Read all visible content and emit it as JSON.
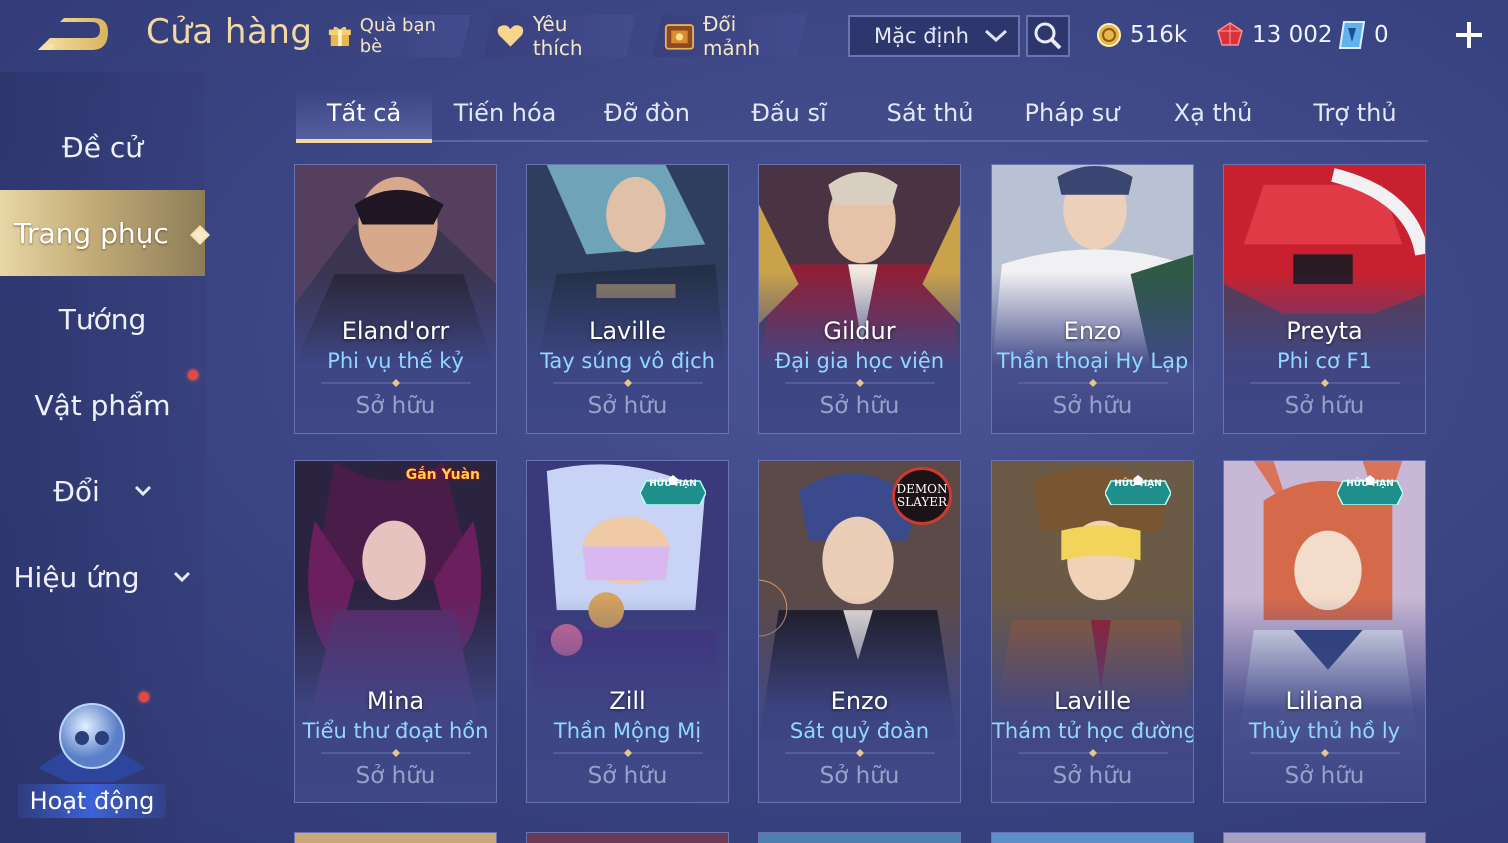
{
  "header": {
    "title": "Cửa hàng",
    "gift_label": "Quà bạn bè",
    "favorite_label": "Yêu thích",
    "exchange_label": "Đổi mảnh",
    "sort_value": "Mặc định",
    "currencies": {
      "gold": "516k",
      "ruby": "13 002",
      "voucher": "0"
    }
  },
  "sidebar": {
    "items": [
      {
        "label": "Đề cử"
      },
      {
        "label": "Trang phục"
      },
      {
        "label": "Tướng"
      },
      {
        "label": "Vật phẩm"
      },
      {
        "label": "Đổi"
      },
      {
        "label": "Hiệu ứng"
      }
    ],
    "activity_label": "Hoạt động"
  },
  "tabs": [
    "Tất cả",
    "Tiến hóa",
    "Đỡ đòn",
    "Đấu sĩ",
    "Sát thủ",
    "Pháp sư",
    "Xạ thủ",
    "Trợ thủ"
  ],
  "cards": [
    {
      "hero": "Eland'orr",
      "skin": "Phi vụ thế kỷ",
      "status": "Sở hữu"
    },
    {
      "hero": "Laville",
      "skin": "Tay súng vô địch",
      "status": "Sở hữu"
    },
    {
      "hero": "Gildur",
      "skin": "Đại gia học viện",
      "status": "Sở hữu"
    },
    {
      "hero": "Enzo",
      "skin": "Thần thoại Hy Lạp",
      "status": "Sở hữu"
    },
    {
      "hero": "Preyta",
      "skin": "Phi cơ F1",
      "status": "Sở hữu"
    },
    {
      "hero": "Mina",
      "skin": "Tiểu thư đoạt hồn",
      "status": "Sở hữu",
      "badge": "Gắn Yuàn"
    },
    {
      "hero": "Zill",
      "skin": "Thần Mộng Mị",
      "status": "Sở hữu",
      "badge": "HỮU HẠN"
    },
    {
      "hero": "Enzo",
      "skin": "Sát quỷ đoàn",
      "status": "Sở hữu",
      "badge": "DEMON SLAYER"
    },
    {
      "hero": "Laville",
      "skin": "Thám tử học đường",
      "status": "Sở hữu",
      "badge": "HỮU HẠN"
    },
    {
      "hero": "Liliana",
      "skin": "Thủy thủ hồ ly",
      "status": "Sở hữu",
      "badge": "HỮU HẠN"
    }
  ],
  "colors": {
    "accent_gold": "#f3d9a1",
    "skin_name": "#8fd8ff",
    "active_tab_underline": "#f3d9a1",
    "notify_dot": "#e8473f"
  }
}
